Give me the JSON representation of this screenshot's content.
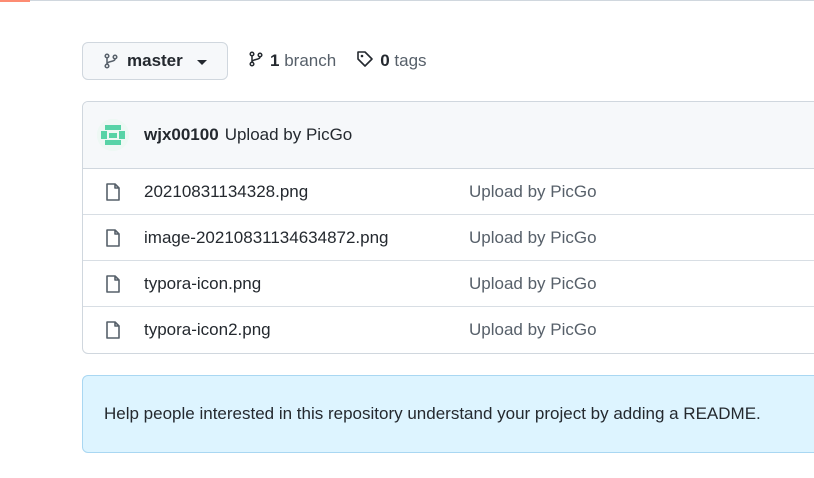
{
  "branch": {
    "current": "master",
    "branch_count": "1",
    "branch_label": "branch",
    "tag_count": "0",
    "tag_label": "tags"
  },
  "commit": {
    "author": "wjx00100",
    "message": "Upload by PicGo"
  },
  "files": [
    {
      "name": "20210831134328.png",
      "message": "Upload by PicGo"
    },
    {
      "name": "image-20210831134634872.png",
      "message": "Upload by PicGo"
    },
    {
      "name": "typora-icon.png",
      "message": "Upload by PicGo"
    },
    {
      "name": "typora-icon2.png",
      "message": "Upload by PicGo"
    }
  ],
  "readme_notice": "Help people interested in this repository understand your project by adding a README.",
  "colors": {
    "accent_tab": "#fd8c73",
    "notice_bg": "#ddf4ff",
    "avatar_green": "#57d3a6"
  }
}
